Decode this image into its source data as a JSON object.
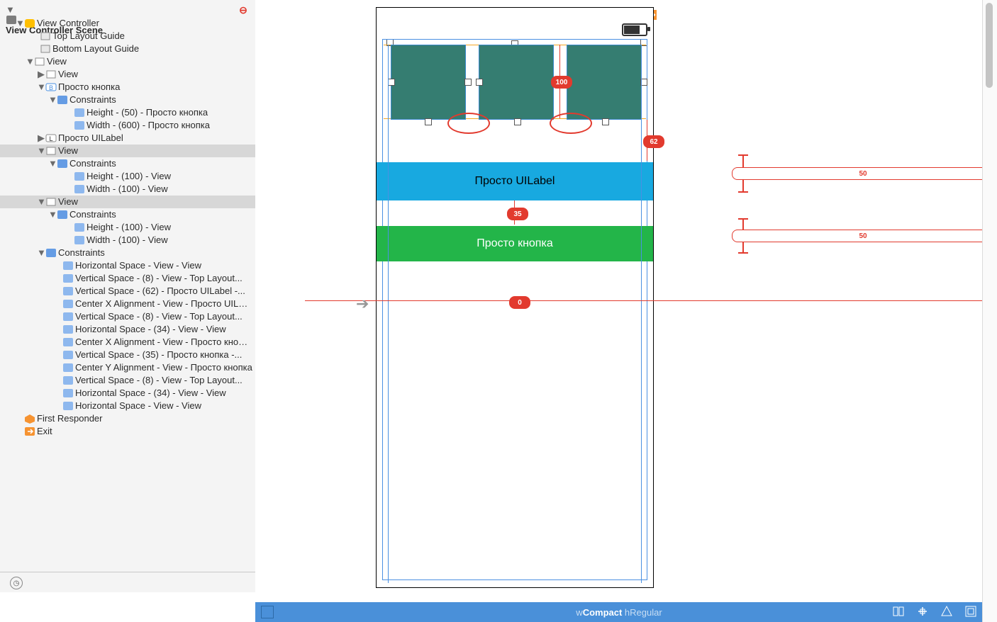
{
  "outline": {
    "scene_title": "View Controller Scene",
    "rows": [
      {
        "pad": 22,
        "tri": "▼",
        "icon": "vc",
        "label": "View Controller"
      },
      {
        "pad": 44,
        "tri": "",
        "icon": "guide",
        "label": "Top Layout Guide"
      },
      {
        "pad": 44,
        "tri": "",
        "icon": "guide",
        "label": "Bottom Layout Guide"
      },
      {
        "pad": 36,
        "tri": "▼",
        "icon": "view",
        "label": "View"
      },
      {
        "pad": 52,
        "tri": "▶",
        "icon": "view",
        "label": "View"
      },
      {
        "pad": 52,
        "tri": "▼",
        "icon": "btn",
        "label": "Просто кнопка"
      },
      {
        "pad": 68,
        "tri": "▼",
        "icon": "cons",
        "label": "Constraints"
      },
      {
        "pad": 92,
        "tri": "",
        "icon": "cval",
        "label": "Height - (50) - Просто кнопка"
      },
      {
        "pad": 92,
        "tri": "",
        "icon": "cval",
        "label": "Width - (600) - Просто кнопка"
      },
      {
        "pad": 52,
        "tri": "▶",
        "icon": "lbl",
        "label": "Просто UILabel"
      },
      {
        "pad": 52,
        "tri": "▼",
        "icon": "view",
        "label": "View",
        "sel": true
      },
      {
        "pad": 68,
        "tri": "▼",
        "icon": "cons",
        "label": "Constraints"
      },
      {
        "pad": 92,
        "tri": "",
        "icon": "cval",
        "label": "Height - (100) - View"
      },
      {
        "pad": 92,
        "tri": "",
        "icon": "cval",
        "label": "Width - (100) - View"
      },
      {
        "pad": 52,
        "tri": "▼",
        "icon": "view",
        "label": "View",
        "sel": true
      },
      {
        "pad": 68,
        "tri": "▼",
        "icon": "cons",
        "label": "Constraints"
      },
      {
        "pad": 92,
        "tri": "",
        "icon": "cval",
        "label": "Height - (100) - View"
      },
      {
        "pad": 92,
        "tri": "",
        "icon": "cval",
        "label": "Width - (100) - View"
      },
      {
        "pad": 52,
        "tri": "▼",
        "icon": "cons",
        "label": "Constraints"
      },
      {
        "pad": 76,
        "tri": "",
        "icon": "cval",
        "label": "Horizontal Space - View - View"
      },
      {
        "pad": 76,
        "tri": "",
        "icon": "cval",
        "label": "Vertical Space - (8) - View - Top Layout..."
      },
      {
        "pad": 76,
        "tri": "",
        "icon": "cval",
        "label": "Vertical Space - (62) - Просто UILabel -..."
      },
      {
        "pad": 76,
        "tri": "",
        "icon": "cval",
        "label": "Center X Alignment - View - Просто UILabel"
      },
      {
        "pad": 76,
        "tri": "",
        "icon": "cval",
        "label": "Vertical Space - (8) - View - Top Layout..."
      },
      {
        "pad": 76,
        "tri": "",
        "icon": "cval",
        "label": "Horizontal Space - (34) - View - View"
      },
      {
        "pad": 76,
        "tri": "",
        "icon": "cval",
        "label": "Center X Alignment - View - Просто кнопка"
      },
      {
        "pad": 76,
        "tri": "",
        "icon": "cval",
        "label": "Vertical Space - (35) - Просто кнопка -..."
      },
      {
        "pad": 76,
        "tri": "",
        "icon": "cval",
        "label": "Center Y Alignment - View - Просто кнопка"
      },
      {
        "pad": 76,
        "tri": "",
        "icon": "cval",
        "label": "Vertical Space - (8) - View - Top Layout..."
      },
      {
        "pad": 76,
        "tri": "",
        "icon": "cval",
        "label": "Horizontal Space - (34) - View - View"
      },
      {
        "pad": 76,
        "tri": "",
        "icon": "cval",
        "label": "Horizontal Space - View - View"
      },
      {
        "pad": 22,
        "tri": "",
        "icon": "cube",
        "label": "First Responder"
      },
      {
        "pad": 22,
        "tri": "",
        "icon": "exit",
        "label": "Exit"
      }
    ]
  },
  "canvas": {
    "label_text": "Просто UILabel",
    "button_text": "Просто кнопка",
    "badges": {
      "hundred": "100",
      "sixtytwo": "62",
      "thirtyfive": "35",
      "zero": "0",
      "fifty_a": "50",
      "fifty_b": "50"
    }
  },
  "status": {
    "w_label": "w",
    "w_value": "Compact",
    "h_label": " h",
    "h_value": "Regular"
  }
}
